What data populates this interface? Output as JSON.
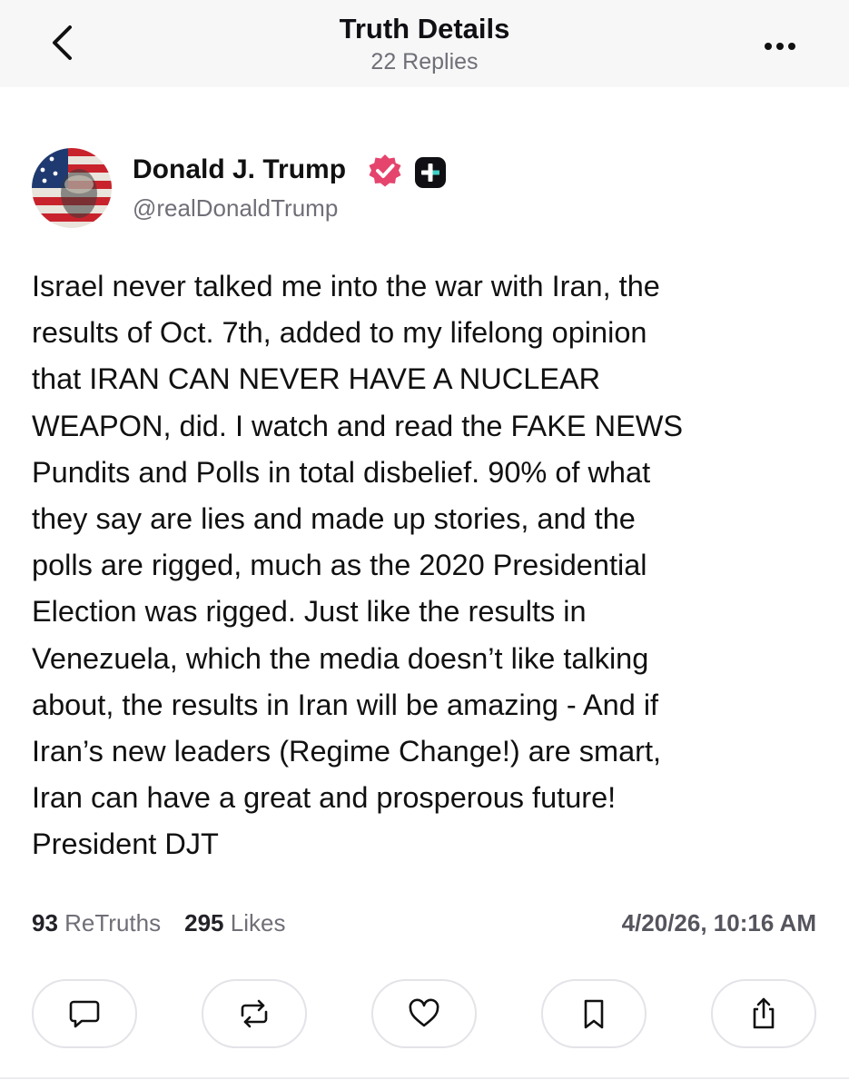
{
  "header": {
    "title": "Truth Details",
    "subtitle": "22 Replies",
    "back_icon": "chevron-left-icon",
    "more_icon": "ellipsis-icon"
  },
  "post": {
    "author_name": "Donald J. Trump",
    "author_handle": "@realDonaldTrump",
    "verified_icon": "verified-badge-icon",
    "verified_color": "#e5446d",
    "plus_icon": "plus-badge-icon",
    "body_lines": [
      "Israel never talked me into the war with Iran, the",
      "results of Oct. 7th, added to my lifelong opinion",
      "that IRAN CAN NEVER HAVE A NUCLEAR",
      "WEAPON, did. I watch and read the FAKE NEWS",
      "Pundits and Polls in total disbelief. 90% of what",
      "they say are lies and made up stories, and the",
      "polls are rigged, much as the 2020 Presidential",
      "Election was rigged. Just like the results in",
      "Venezuela, which the media doesn’t like talking",
      "about, the results in Iran will be amazing - And if",
      "Iran’s new leaders (Regime Change!) are smart,",
      "Iran can have a great and prosperous future!",
      "President DJT"
    ]
  },
  "stats": {
    "retruths_count": "93",
    "retruths_label": "ReTruths",
    "likes_count": "295",
    "likes_label": "Likes",
    "timestamp": "4/20/26, 10:16 AM"
  },
  "actions": [
    {
      "icon": "reply-icon"
    },
    {
      "icon": "retruth-icon"
    },
    {
      "icon": "heart-icon"
    },
    {
      "icon": "bookmark-icon"
    },
    {
      "icon": "share-icon"
    }
  ]
}
